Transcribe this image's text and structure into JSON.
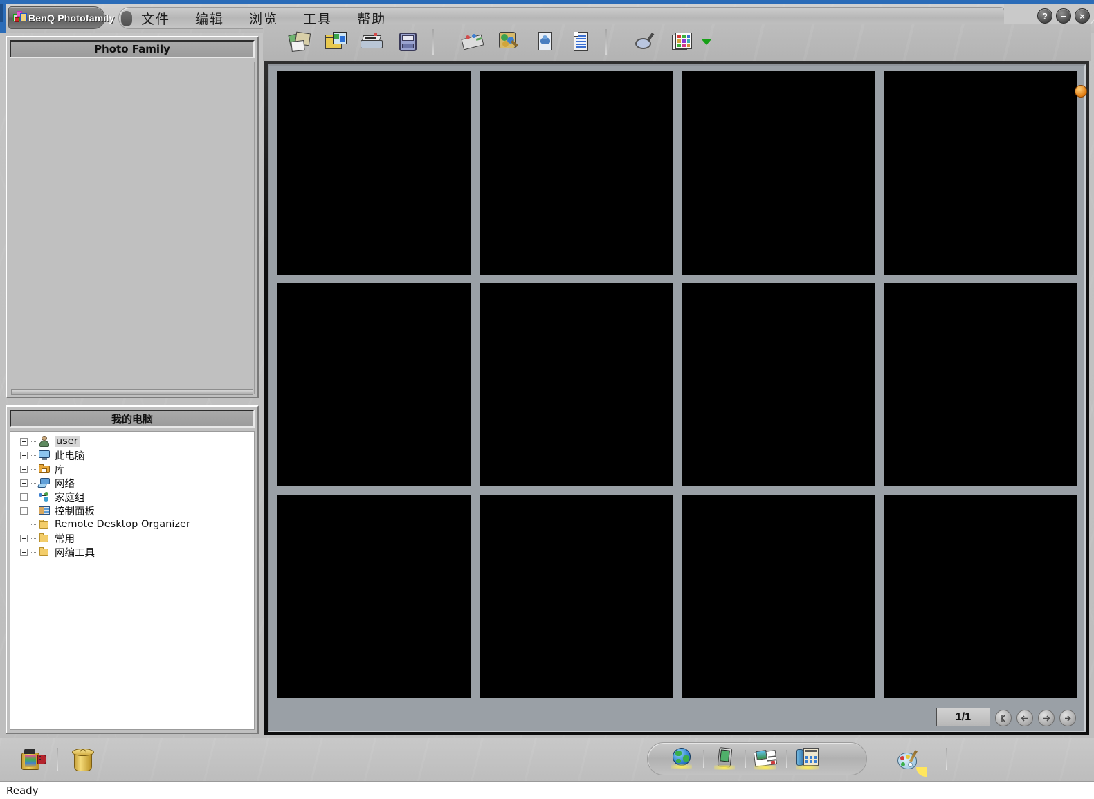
{
  "window": {
    "app_title": "BenQ Photofamily",
    "app_icon": "photo-frames-icon",
    "controls": [
      {
        "name": "help-button",
        "glyph": "?"
      },
      {
        "name": "minimize-button",
        "glyph": "−"
      },
      {
        "name": "close-button",
        "glyph": "×"
      }
    ]
  },
  "menu": {
    "items": [
      {
        "label": "文件",
        "name": "menu-file"
      },
      {
        "label": "编辑",
        "name": "menu-edit"
      },
      {
        "label": "浏览",
        "name": "menu-browse"
      },
      {
        "label": "工具",
        "name": "menu-tools"
      },
      {
        "label": "帮助",
        "name": "menu-help"
      }
    ]
  },
  "toolbar": {
    "groups": [
      {
        "buttons": [
          {
            "name": "albums-icon",
            "title": "Albums"
          },
          {
            "name": "folder-images-icon",
            "title": "Folder"
          },
          {
            "name": "scanner-icon",
            "title": "Scanner"
          },
          {
            "name": "storage-drive-icon",
            "title": "Storage"
          }
        ]
      },
      {
        "buttons": [
          {
            "name": "slideshow-icon",
            "title": "Slideshow"
          },
          {
            "name": "edit-image-icon",
            "title": "Edit Image"
          },
          {
            "name": "preview-image-icon",
            "title": "Preview"
          },
          {
            "name": "document-icon",
            "title": "Document"
          }
        ]
      },
      {
        "buttons": [
          {
            "name": "magnifier-icon",
            "title": "Search"
          },
          {
            "name": "thumbnail-view-icon",
            "title": "Thumbnail View"
          }
        ],
        "has_caret": true
      }
    ],
    "caret_color": "#16a016"
  },
  "left_panel": {
    "photo_family": {
      "header": "Photo Family",
      "items": []
    },
    "my_computer": {
      "header": "我的电脑",
      "tree": [
        {
          "label": "user",
          "icon": "user-icon",
          "expandable": true,
          "selected": true
        },
        {
          "label": "此电脑",
          "icon": "computer-icon",
          "expandable": true,
          "selected": false
        },
        {
          "label": "库",
          "icon": "library-icon",
          "expandable": true,
          "selected": false
        },
        {
          "label": "网络",
          "icon": "network-icon",
          "expandable": true,
          "selected": false
        },
        {
          "label": "家庭组",
          "icon": "homegroup-icon",
          "expandable": true,
          "selected": false
        },
        {
          "label": "控制面板",
          "icon": "control-panel-icon",
          "expandable": true,
          "selected": false
        },
        {
          "label": "Remote Desktop Organizer",
          "icon": "folder-icon",
          "expandable": false,
          "selected": false
        },
        {
          "label": "常用",
          "icon": "folder-icon",
          "expandable": true,
          "selected": false
        },
        {
          "label": "网编工具",
          "icon": "folder-icon",
          "expandable": true,
          "selected": false
        }
      ]
    }
  },
  "viewer": {
    "thumbnail_count": 12,
    "columns": 4,
    "rows": 3,
    "cell_color": "#000000",
    "background_color": "#9aa0a6",
    "pager": {
      "page_label": "1/1",
      "buttons": [
        {
          "name": "first-page-button",
          "glyph": "first"
        },
        {
          "name": "previous-page-button",
          "glyph": "prev"
        },
        {
          "name": "next-page-button",
          "glyph": "next"
        },
        {
          "name": "last-page-button",
          "glyph": "last"
        }
      ]
    }
  },
  "bottom_bar": {
    "left_items": [
      {
        "name": "film-inbox-icon",
        "label": "Inbox"
      },
      {
        "name": "trash-can-icon",
        "label": "Trash"
      }
    ],
    "capsule_items": [
      {
        "name": "web-globe-icon",
        "title": "Web"
      },
      {
        "name": "pda-device-icon",
        "title": "PDA"
      },
      {
        "name": "email-postcard-icon",
        "title": "E-mail"
      },
      {
        "name": "fax-machine-icon",
        "title": "Fax"
      }
    ],
    "right_items": [
      {
        "name": "palette-icon",
        "title": "Palette"
      }
    ]
  },
  "status_bar": {
    "message": "Ready"
  }
}
